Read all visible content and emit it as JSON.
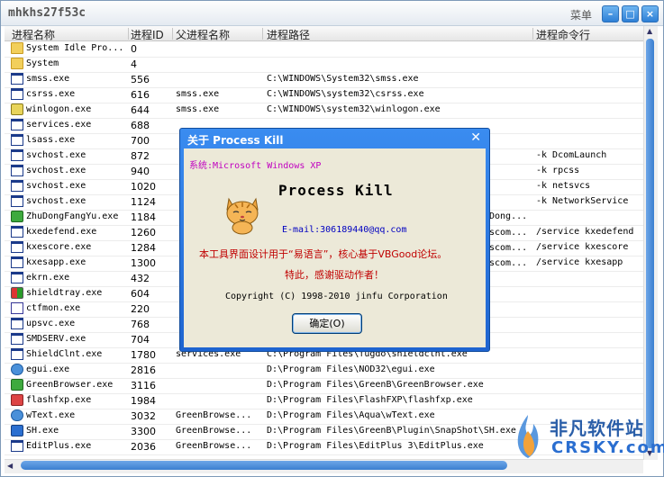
{
  "window": {
    "title": "mhkhs27f53c",
    "menu_label": "菜单"
  },
  "columns": [
    "进程名称",
    "进程ID",
    "父进程名称",
    "进程路径",
    "进程命令行"
  ],
  "rows": [
    {
      "icon": "folder",
      "name": "System Idle Pro...",
      "pid": "0",
      "parent": "",
      "path": "",
      "cmd": ""
    },
    {
      "icon": "folder",
      "name": "System",
      "pid": "4",
      "parent": "",
      "path": "",
      "cmd": ""
    },
    {
      "icon": "exe",
      "name": "smss.exe",
      "pid": "556",
      "parent": "",
      "path": "C:\\WINDOWS\\System32\\smss.exe",
      "cmd": ""
    },
    {
      "icon": "exe",
      "name": "csrss.exe",
      "pid": "616",
      "parent": "smss.exe",
      "path": "C:\\WINDOWS\\system32\\csrss.exe",
      "cmd": ""
    },
    {
      "icon": "gear",
      "name": "winlogon.exe",
      "pid": "644",
      "parent": "smss.exe",
      "path": "C:\\WINDOWS\\system32\\winlogon.exe",
      "cmd": ""
    },
    {
      "icon": "exe",
      "name": "services.exe",
      "pid": "688",
      "parent": "",
      "path": "",
      "cmd": ""
    },
    {
      "icon": "exe",
      "name": "lsass.exe",
      "pid": "700",
      "parent": "",
      "path": "",
      "cmd": ""
    },
    {
      "icon": "exe",
      "name": "svchost.exe",
      "pid": "872",
      "parent": "",
      "path": "",
      "cmd": "-k DcomLaunch"
    },
    {
      "icon": "exe",
      "name": "svchost.exe",
      "pid": "940",
      "parent": "",
      "path": "",
      "cmd": "-k rpcss"
    },
    {
      "icon": "exe",
      "name": "svchost.exe",
      "pid": "1020",
      "parent": "",
      "path": "",
      "cmd": "-k netsvcs"
    },
    {
      "icon": "exe",
      "name": "svchost.exe",
      "pid": "1124",
      "parent": "",
      "path": "",
      "cmd": "-k NetworkService"
    },
    {
      "icon": "green",
      "name": "ZhuDongFangYu.exe",
      "pid": "1184",
      "parent": "",
      "path": "",
      "cmd": ""
    },
    {
      "icon": "exe",
      "name": "kxedefend.exe",
      "pid": "1260",
      "parent": "",
      "path": "",
      "cmd": "/service kxedefend"
    },
    {
      "icon": "exe",
      "name": "kxescore.exe",
      "pid": "1284",
      "parent": "",
      "path": "",
      "cmd": "/service kxescore"
    },
    {
      "icon": "exe",
      "name": "kxesapp.exe",
      "pid": "1300",
      "parent": "",
      "path": "",
      "cmd": "/service kxesapp"
    },
    {
      "icon": "exe",
      "name": "ekrn.exe",
      "pid": "432",
      "parent": "",
      "path": "",
      "cmd": ""
    },
    {
      "icon": "shield",
      "name": "shieldtray.exe",
      "pid": "604",
      "parent": "",
      "path": "",
      "cmd": ""
    },
    {
      "icon": "pen",
      "name": "ctfmon.exe",
      "pid": "220",
      "parent": "",
      "path": "",
      "cmd": ""
    },
    {
      "icon": "exe",
      "name": "upsvc.exe",
      "pid": "768",
      "parent": "",
      "path": "",
      "cmd": ""
    },
    {
      "icon": "exe",
      "name": "SMDSERV.exe",
      "pid": "704",
      "parent": "",
      "path": "",
      "cmd": ""
    },
    {
      "icon": "exe",
      "name": "ShieldClnt.exe",
      "pid": "1780",
      "parent": "services.exe",
      "path": "C:\\Program Files\\fugdo\\shieldclnt.exe",
      "cmd": ""
    },
    {
      "icon": "orb",
      "name": "egui.exe",
      "pid": "2816",
      "parent": "",
      "path": "D:\\Program Files\\NOD32\\egui.exe",
      "cmd": ""
    },
    {
      "icon": "green",
      "name": "GreenBrowser.exe",
      "pid": "3116",
      "parent": "",
      "path": "D:\\Program Files\\GreenB\\GreenBrowser.exe",
      "cmd": ""
    },
    {
      "icon": "flash",
      "name": "flashfxp.exe",
      "pid": "1984",
      "parent": "",
      "path": "D:\\Program Files\\FlashFXP\\flashfxp.exe",
      "cmd": ""
    },
    {
      "icon": "orb",
      "name": "wText.exe",
      "pid": "3032",
      "parent": "GreenBrowse...",
      "path": "D:\\Program Files\\Aqua\\wText.exe",
      "cmd": ""
    },
    {
      "icon": "blue",
      "name": "SH.exe",
      "pid": "3300",
      "parent": "GreenBrowse...",
      "path": "D:\\Program Files\\GreenB\\Plugin\\SnapShot\\SH.exe",
      "cmd": ""
    },
    {
      "icon": "exe",
      "name": "EditPlus.exe",
      "pid": "2036",
      "parent": "GreenBrowse...",
      "path": "D:\\Program Files\\EditPlus 3\\EditPlus.exe",
      "cmd": ""
    }
  ],
  "peek": {
    "dong": "Dong...",
    "scom1": "scom...",
    "scom2": "scom...",
    "scom3": "scom..."
  },
  "dialog": {
    "title": "关于 Process Kill",
    "system": "系统:Microsoft Windows XP",
    "app_name": "Process Kill",
    "email": "E-mail:306189440@qq.com",
    "description": "本工具界面设计用于“易语言”，核心基于VBGood论坛。",
    "thanks": "特此，感谢驱动作者！",
    "copyright": "Copyright (C) 1998-2010 jinfu Corporation",
    "ok_label": "确定(O)"
  },
  "watermark": {
    "cn": "非凡软件站",
    "en": "CRSKY.com"
  }
}
